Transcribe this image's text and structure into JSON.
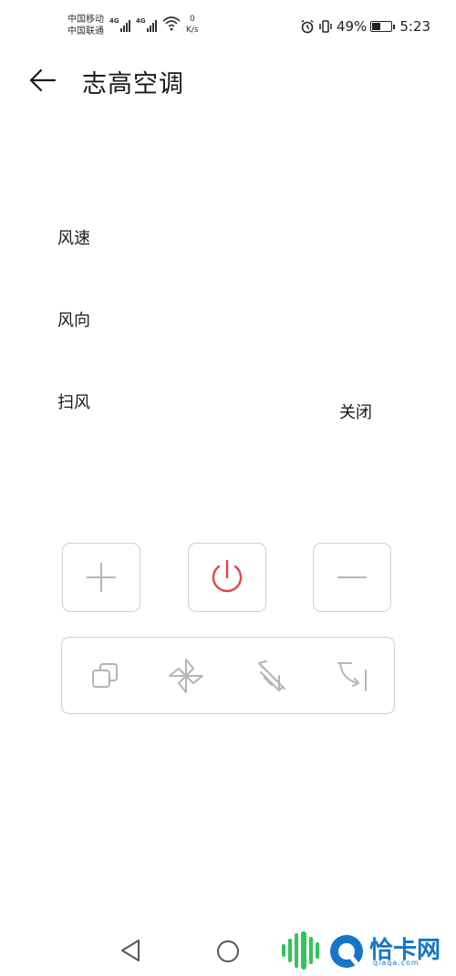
{
  "status_bar": {
    "carrier_1": "中国移动",
    "carrier_2": "中国联通",
    "net_1": "4G",
    "net_2": "4G",
    "speed_value": "0",
    "speed_unit": "K/s",
    "battery_percent": "49%",
    "battery_level": 0.49,
    "time": "5:23"
  },
  "header": {
    "title": "志高空调"
  },
  "settings": {
    "fan_speed_label": "风速",
    "direction_label": "风向",
    "swing_label": "扫风",
    "swing_value": "关闭"
  },
  "controls": {
    "power_color": "#e0474c",
    "icon_color": "#b5b5b5"
  },
  "watermark": {
    "brand": "恰卡网",
    "domain": "qiaqa.com"
  }
}
